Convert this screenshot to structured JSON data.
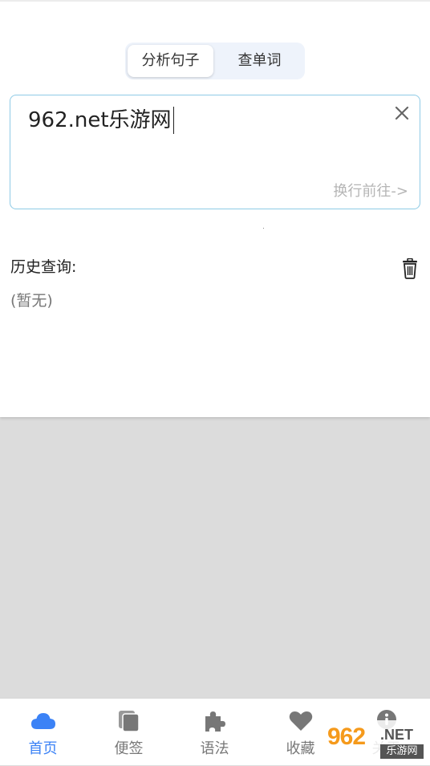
{
  "segmented": {
    "options": [
      {
        "label": "分析句子",
        "active": true
      },
      {
        "label": "查单词",
        "active": false
      }
    ]
  },
  "input": {
    "value": "962.net乐游网",
    "go_hint": "换行前往->",
    "clear_icon": "close-icon"
  },
  "history": {
    "title": "历史查询:",
    "empty_text": "(暂无)",
    "clear_icon": "trash-icon"
  },
  "tabbar": {
    "active_color": "#3b82f6",
    "inactive_color": "#777777",
    "tabs": [
      {
        "label": "首页",
        "icon": "cloud-icon",
        "active": true
      },
      {
        "label": "便签",
        "icon": "notes-icon",
        "active": false
      },
      {
        "label": "语法",
        "icon": "puzzle-icon",
        "active": false
      },
      {
        "label": "收藏",
        "icon": "heart-icon",
        "active": false
      },
      {
        "label": "关于",
        "icon": "info-icon",
        "active": false
      }
    ]
  },
  "watermark": {
    "number": "962",
    "net": ".NET",
    "sub": "乐游网"
  }
}
